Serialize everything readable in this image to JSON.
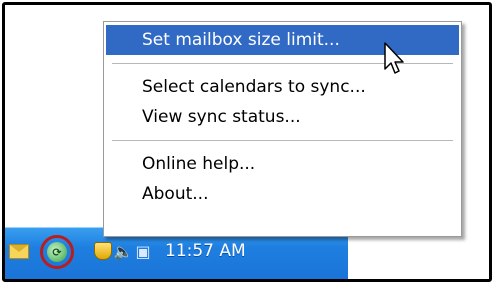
{
  "context_menu": {
    "items": [
      {
        "label": "Set mailbox size limit...",
        "selected": true
      },
      {
        "label": "Select calendars to sync..."
      },
      {
        "label": "View sync status..."
      },
      {
        "label": "Online help..."
      },
      {
        "label": "About..."
      }
    ],
    "highlight_color": "#316ac5"
  },
  "taskbar": {
    "clock": "11:57 AM",
    "tray_icons": [
      "mail-icon",
      "sync-icon",
      "shield-icon",
      "speaker-icon",
      "network-icon"
    ],
    "color": "#1e7fe0"
  },
  "annotation": {
    "highlight_ring_color": "#b91d1d"
  }
}
